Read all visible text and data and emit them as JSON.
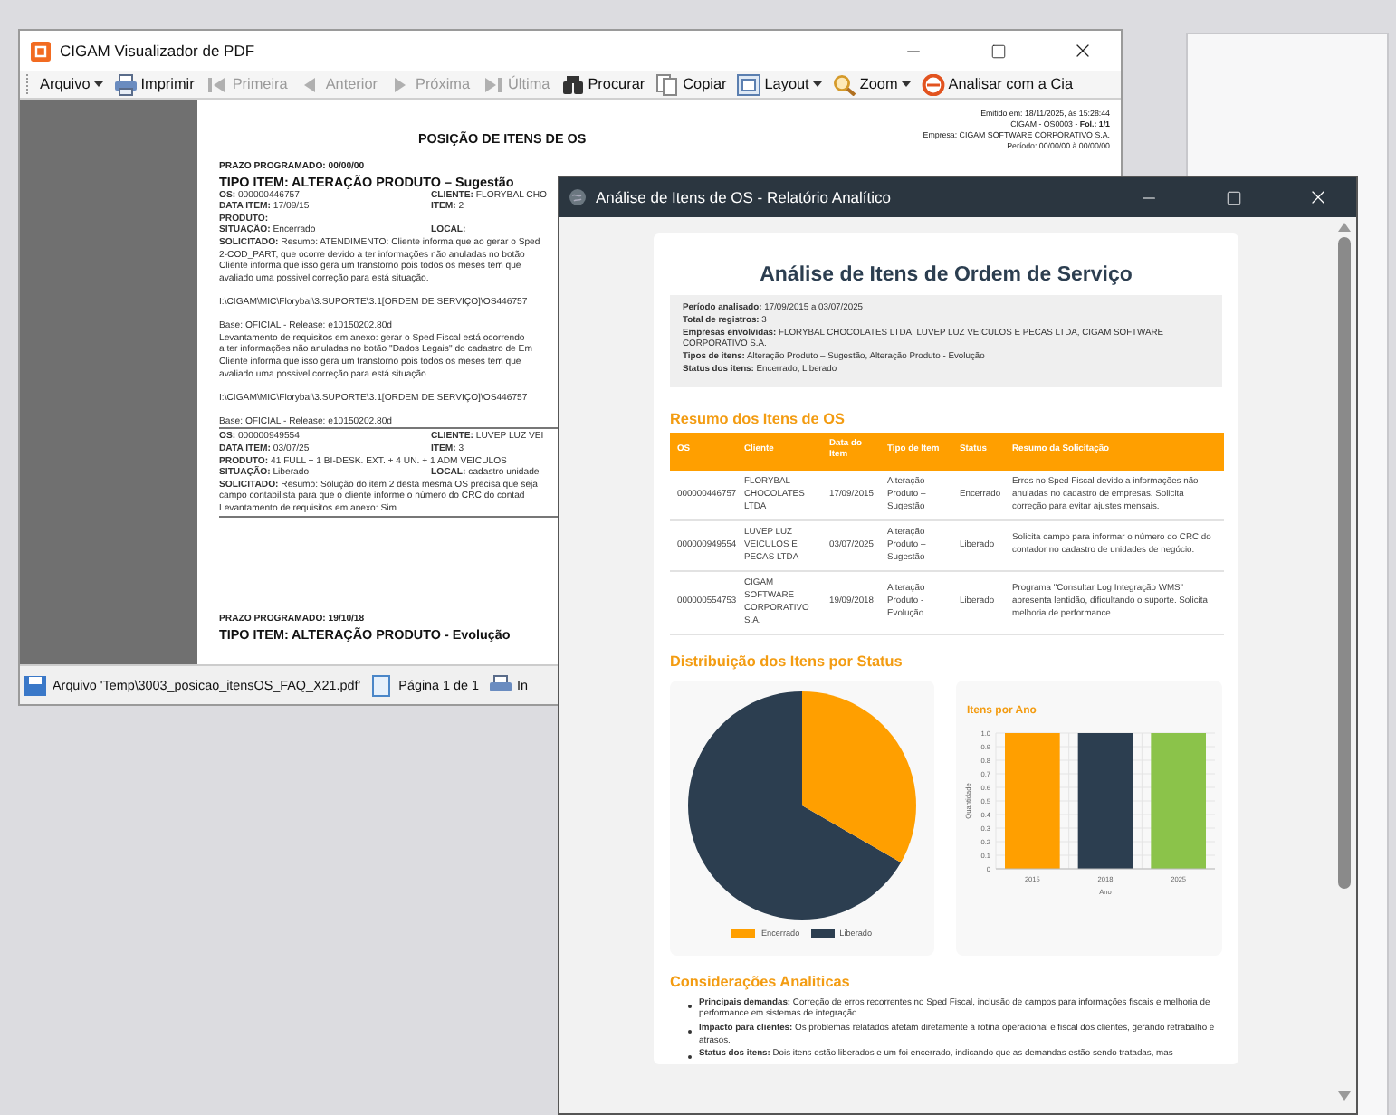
{
  "pdf_window": {
    "title": "CIGAM Visualizador de PDF",
    "toolbar": [
      {
        "label": "Arquivo",
        "disabled": false,
        "dropdown": true
      },
      {
        "label": "Imprimir",
        "disabled": false,
        "dropdown": false
      },
      {
        "label": "Primeira",
        "disabled": true,
        "dropdown": false
      },
      {
        "label": "Anterior",
        "disabled": true,
        "dropdown": false
      },
      {
        "label": "Próxima",
        "disabled": true,
        "dropdown": false
      },
      {
        "label": "Última",
        "disabled": true,
        "dropdown": false
      },
      {
        "label": "Procurar",
        "disabled": false,
        "dropdown": false
      },
      {
        "label": "Copiar",
        "disabled": false,
        "dropdown": false
      },
      {
        "label": "Layout",
        "disabled": false,
        "dropdown": true
      },
      {
        "label": "Zoom",
        "disabled": false,
        "dropdown": true
      },
      {
        "label": "Analisar com a Cia",
        "disabled": false,
        "dropdown": false
      }
    ],
    "page": {
      "title": "POSIÇÃO DE ITENS DE OS",
      "header_lines": [
        "Emitido em: 18/11/2025, às 15:28:44",
        "CIGAM - OS0003 - **Fol.: 1/1**",
        "Empresa: CIGAM SOFTWARE CORPORATIVO S.A.",
        "Período: 00/00/00 à 00/00/00"
      ],
      "blocks": [
        {
          "lines": [
            {
              "kind": "label",
              "text": "PRAZO PROGRAMADO: 00/00/00"
            },
            {
              "kind": "title",
              "text": "TIPO ITEM: ALTERAÇÃO PRODUTO – Sugestão"
            },
            {
              "kind": "pair",
              "left": "**OS:** 000000446757",
              "right": "**CLIENTE:** FLORYBAL CHO"
            },
            {
              "kind": "pair",
              "left": "**DATA ITEM:** 17/09/15",
              "right": "**ITEM:**   2"
            },
            {
              "kind": "text",
              "text": "**PRODUTO:**"
            },
            {
              "kind": "pair",
              "left": "**SITUAÇÃO:** Encerrado",
              "right": "**LOCAL:**"
            },
            {
              "kind": "text",
              "text": "**SOLICITADO:** Resumo: ATENDIMENTO: Cliente informa que ao gerar o Sped"
            },
            {
              "kind": "text",
              "text": "2-COD_PART, que ocorre devido a ter informações não anuladas no botão"
            },
            {
              "kind": "text",
              "text": "Cliente informa que isso gera um transtorno pois todos os meses tem que"
            },
            {
              "kind": "text",
              "text": "avaliado uma possivel correção para está situação."
            },
            {
              "kind": "blank"
            },
            {
              "kind": "text",
              "text": "I:\\CIGAM\\MIC\\Florybal\\3.SUPORTE\\3.1[ORDEM DE SERVIÇO]\\OS446757"
            },
            {
              "kind": "blank"
            },
            {
              "kind": "text",
              "text": "Base: OFICIAL - Release: e10150202.80d"
            },
            {
              "kind": "text",
              "text": "Levantamento de requisitos em anexo: gerar o Sped Fiscal está ocorrendo"
            },
            {
              "kind": "text",
              "text": "a ter informações não anuladas no botão \"Dados Legais\" do cadastro de Em"
            },
            {
              "kind": "text",
              "text": "Cliente informa que isso gera um transtorno pois todos os meses tem que"
            },
            {
              "kind": "text",
              "text": "avaliado uma possivel correção para está situação."
            },
            {
              "kind": "blank"
            },
            {
              "kind": "text",
              "text": "I:\\CIGAM\\MIC\\Florybal\\3.SUPORTE\\3.1[ORDEM DE SERVIÇO]\\OS446757"
            },
            {
              "kind": "blank"
            },
            {
              "kind": "text",
              "text": "Base: OFICIAL - Release: e10150202.80d"
            },
            {
              "kind": "rule"
            },
            {
              "kind": "pair",
              "left": "**OS:** 000000949554",
              "right": "**CLIENTE:** LUVEP LUZ VEI"
            },
            {
              "kind": "pair",
              "left": "**DATA ITEM:** 03/07/25",
              "right": "**ITEM:**   3"
            },
            {
              "kind": "text",
              "text": "**PRODUTO:** 41 FULL + 1 BI-DESK. EXT. + 4 UN. + 1 ADM VEICULOS"
            },
            {
              "kind": "pair",
              "left": "**SITUAÇÃO:** Liberado",
              "right": "**LOCAL:** cadastro unidade"
            },
            {
              "kind": "text",
              "text": "**SOLICITADO:** Resumo: Solução do item 2 desta mesma OS precisa que seja"
            },
            {
              "kind": "text",
              "text": "campo contabilista para que o cliente informe o número do CRC do contad"
            },
            {
              "kind": "text",
              "text": "Levantamento de requisitos em anexo: Sim"
            },
            {
              "kind": "rule"
            }
          ]
        },
        {
          "lines": [
            {
              "kind": "label",
              "text": "PRAZO PROGRAMADO: 19/10/18"
            },
            {
              "kind": "title",
              "text": "TIPO ITEM: ALTERAÇÃO PRODUTO - Evolução"
            }
          ]
        }
      ]
    },
    "status_bar": [
      "Arquivo 'Temp\\3003_posicao_itensOS_FAQ_X21.pdf'",
      "Página 1 de 1",
      "In"
    ]
  },
  "report_window": {
    "title": "Análise de Itens de OS - Relatório Analítico",
    "heading": "Análise de Itens de Ordem de Serviço",
    "summary": [
      "**Período analisado:** 17/09/2015 a 03/07/2025",
      "**Total de registros:** 3",
      "**Empresas envolvidas:** FLORYBAL CHOCOLATES LTDA, LUVEP LUZ VEICULOS E PECAS LTDA, CIGAM SOFTWARE CORPORATIVO S.A.",
      "**Tipos de itens:** Alteração Produto – Sugestão, Alteração Produto - Evolução",
      "**Status dos itens:** Encerrado, Liberado"
    ],
    "table_title": "Resumo dos Itens de OS",
    "table": {
      "columns": [
        "OS",
        "Cliente",
        "Data do Item",
        "Tipo de Item",
        "Status",
        "Resumo da Solicitação"
      ],
      "rows": [
        [
          "000000446757",
          "FLORYBAL CHOCOLATES LTDA",
          "17/09/2015",
          "Alteração Produto – Sugestão",
          "Encerrado",
          "Erros no Sped Fiscal devido a informações não anuladas no cadastro de empresas. Solicita correção para evitar ajustes mensais."
        ],
        [
          "000000949554",
          "LUVEP LUZ VEICULOS E PECAS LTDA",
          "03/07/2025",
          "Alteração Produto – Sugestão",
          "Liberado",
          "Solicita campo para informar o número do CRC do contador no cadastro de unidades de negócio."
        ],
        [
          "000000554753",
          "CIGAM SOFTWARE CORPORATIVO S.A.",
          "19/09/2018",
          "Alteração Produto - Evolução",
          "Liberado",
          "Programa \"Consultar Log Integração WMS\" apresenta lentidão, dificultando o suporte. Solicita melhoria de performance."
        ]
      ]
    },
    "charts_title": "Distribuição dos Itens por Status",
    "pie_legend": [
      {
        "label": "Encerrado",
        "color": "#ff9f00"
      },
      {
        "label": "Liberado",
        "color": "#2c3e50"
      }
    ],
    "bar_chart": {
      "chart_data": {
        "type": "bar",
        "title": "Itens por Ano",
        "xlabel": "Ano",
        "ylabel": "Quantidade",
        "categories": [
          "2015",
          "2018",
          "2025"
        ],
        "grid": true,
        "values": [
          1,
          1,
          1
        ],
        "colors": [
          "#ff9f00",
          "#2c3e50",
          "#8bc34a"
        ],
        "ylim": [
          0,
          1
        ],
        "yticks": [
          {
            "value": 0,
            "label": "0"
          },
          {
            "value": 0.1,
            "label": "0.1"
          },
          {
            "value": 0.2,
            "label": "0.2"
          },
          {
            "value": 0.3,
            "label": "0.3"
          },
          {
            "value": 0.4,
            "label": "0.4"
          },
          {
            "value": 0.5,
            "label": "0.5"
          },
          {
            "value": 0.6,
            "label": "0.6"
          },
          {
            "value": 0.7,
            "label": "0.7"
          },
          {
            "value": 0.8,
            "label": "0.8"
          },
          {
            "value": 0.9,
            "label": "0.9"
          },
          {
            "value": 1,
            "label": "1.0"
          }
        ]
      }
    },
    "considerations_title": "Considerações Analiticas",
    "considerations": [
      "**Principais demandas:** Correção de erros recorrentes no Sped Fiscal, inclusão de campos para informações fiscais e melhoria de performance em sistemas de integração.",
      "**Impacto para clientes:** Os problemas relatados afetam diretamente a rotina operacional e fiscal dos clientes, gerando retrabalho e atrasos.",
      "**Status dos itens:** Dois itens estão liberados e um foi encerrado, indicando que as demandas estão sendo tratadas, mas"
    ]
  }
}
